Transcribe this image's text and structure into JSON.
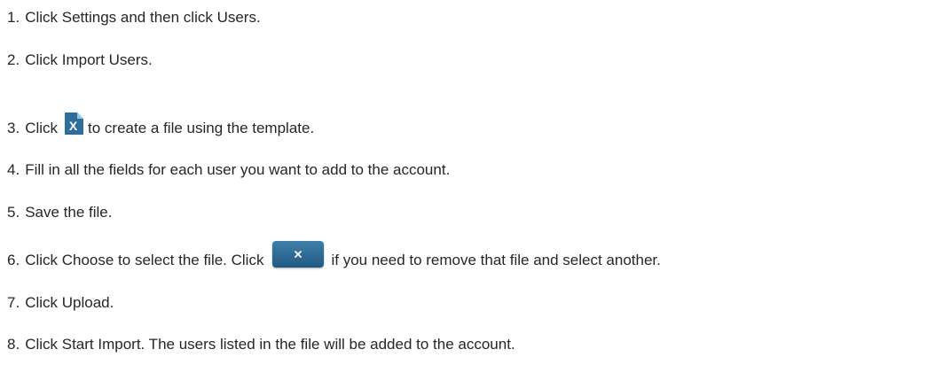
{
  "steps": [
    {
      "num": "1.",
      "text": "Click Settings and then click Users."
    },
    {
      "num": "2.",
      "text": "Click Import Users."
    },
    {
      "num": "3.",
      "before": "Click",
      "icon": "excel-file-icon",
      "after": "to create a file using the template."
    },
    {
      "num": "4.",
      "text": "Fill in all the fields for each user you want to add to the account."
    },
    {
      "num": "5.",
      "text": "Save the file."
    },
    {
      "num": "6.",
      "before": "Click Choose to select the file. Click",
      "icon": "close-icon",
      "after": "if you need to remove that file and select another."
    },
    {
      "num": "7.",
      "text": "Click Upload."
    },
    {
      "num": "8.",
      "text": "Click Start Import. The users listed in the file will be added to the account."
    }
  ],
  "colors": {
    "text": "#262626",
    "icon_blue": "#1f5a82",
    "icon_blue_light": "#3f7fa8"
  }
}
